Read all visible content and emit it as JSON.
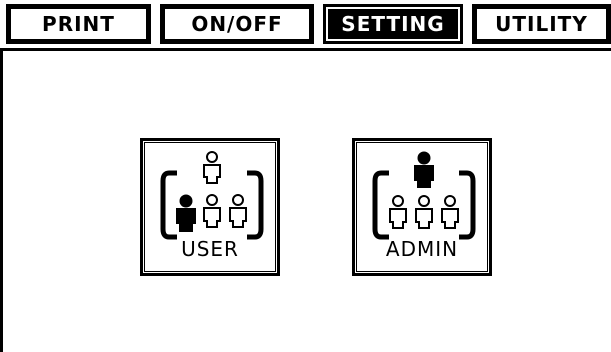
{
  "tabs": [
    {
      "label": "PRINT",
      "active": false
    },
    {
      "label": "ON/OFF",
      "active": false
    },
    {
      "label": "SETTING",
      "active": true
    },
    {
      "label": "UTILITY",
      "active": false
    }
  ],
  "buttons": {
    "user": {
      "label": "USER",
      "icon": "user-group-icon"
    },
    "admin": {
      "label": "ADMIN",
      "icon": "admin-group-icon"
    }
  }
}
